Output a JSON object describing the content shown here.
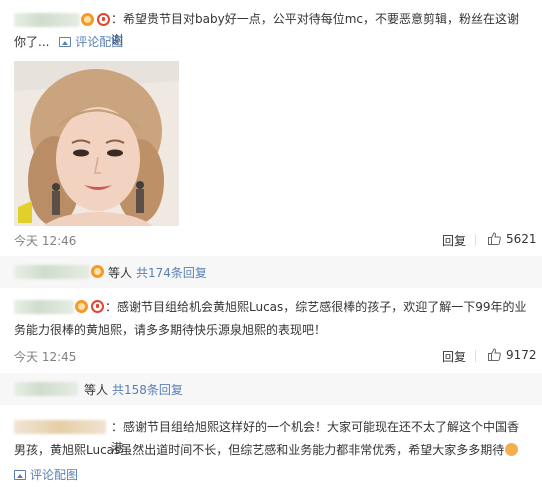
{
  "comment1": {
    "text_line1": "：希望贵节目对baby好一点，公平对待每位mc，不要恶意剪辑，粉丝在这谢谢",
    "text_line2": "你了...",
    "view_image": "评论配图",
    "time": "今天 12:46",
    "reply": "回复",
    "likes": "5621"
  },
  "sub1": {
    "label": "等人",
    "count": "共174条回复"
  },
  "comment2": {
    "text_line1": "：感谢节目组给机会黄旭熙Lucas，综艺感很棒的孩子，欢迎了解一下99年的业",
    "text_line2": "务能力很棒的黄旭熙，请多多期待快乐源泉旭熙的表现吧！",
    "time": "今天 12:45",
    "reply": "回复",
    "likes": "9172"
  },
  "sub2": {
    "label": "等人",
    "count": "共158条回复"
  },
  "comment3": {
    "text_line1": "：感谢节目组给旭熙这样好的一个机会！大家可能现在还不太了解这个中国香港",
    "text_line2": "男孩，黄旭熙Lucas虽然出道时间不长，但综艺感和业务能力都非常优秀，希望大家多多期待",
    "view_image": "评论配图"
  },
  "colors": {
    "link": "#5a7fb5",
    "meta": "#808080",
    "subrow_bg": "#f7f7f7"
  },
  "icons": {
    "image": "image-icon",
    "like": "thumbs-up-icon",
    "badge": "vip-badge-icon"
  }
}
